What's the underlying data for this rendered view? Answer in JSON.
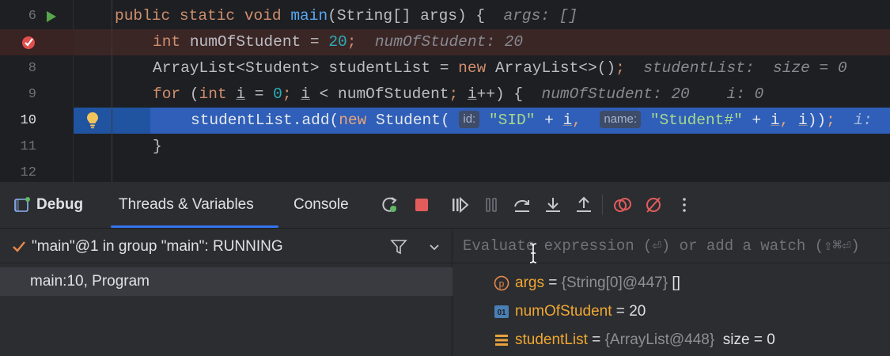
{
  "editor": {
    "lines": [
      {
        "num": "6"
      },
      {
        "num": ""
      },
      {
        "num": "8"
      },
      {
        "num": "9"
      },
      {
        "num": "10"
      },
      {
        "num": "11"
      },
      {
        "num": "12"
      }
    ],
    "hints": {
      "args": "args: []",
      "num_of_student": "numOfStudent: 20",
      "student_list": "studentList:  size = 0",
      "loop_num": "numOfStudent: 20",
      "loop_i": "i: 0",
      "line10_i": "i:"
    },
    "param_hints": {
      "id": "id:",
      "name": "name:"
    }
  },
  "debug": {
    "title": "Debug",
    "tabs": [
      "Threads & Variables",
      "Console"
    ],
    "thread": "\"main\"@1 in group \"main\": RUNNING",
    "frame": "main:10, Program",
    "eval_placeholder": "Evaluate expression (⏎) or add a watch (⇧⌘⏎)",
    "variables": [
      {
        "name": "args",
        "eq": " = ",
        "type": "{String[0]@447}",
        "value": " []",
        "icon": "parameter-icon"
      },
      {
        "name": "numOfStudent",
        "eq": " = ",
        "type": "",
        "value": "20",
        "icon": "primitive-icon"
      },
      {
        "name": "studentList",
        "eq": " = ",
        "type": "{ArrayList@448}",
        "value": "  size = 0",
        "icon": "list-icon"
      }
    ]
  },
  "colors": {
    "accent": "#3574f0",
    "execution_line": "#2154a0",
    "breakpoint_line": "#3b2626",
    "variable_name": "#f0a732"
  }
}
